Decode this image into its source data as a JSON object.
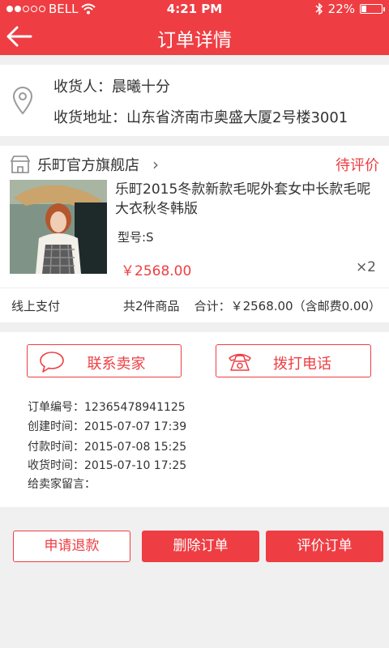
{
  "status_bar": {
    "carrier": "BELL",
    "time": "4:21 PM",
    "battery": "22%",
    "battery_level": 0.22
  },
  "nav": {
    "title": "订单详情"
  },
  "address": {
    "recipient_label": "收货人：",
    "recipient_name": "晨曦十分",
    "address_label": "收货地址：",
    "address_value": "山东省济南市奥盛大厦2号楼3001"
  },
  "order": {
    "shop_name": "乐町官方旗舰店",
    "status": "待评价",
    "product": {
      "name": "乐町2015冬款新款毛呢外套女中长款毛呢大衣秋冬韩版",
      "model": "型号:S",
      "price": "￥2568.00",
      "quantity": "×2"
    },
    "payment_method": "线上支付",
    "item_count": "共2件商品",
    "total": "合计：￥2568.00（含邮费0.00）"
  },
  "contact": {
    "seller_label": "联系卖家",
    "call_label": "拨打电话"
  },
  "info": {
    "order_no": "订单编号：12365478941125",
    "created": "创建时间：2015-07-07 17:39",
    "paid": "付款时间：2015-07-08  15:25",
    "received": "收货时间：2015-07-10  17:25",
    "message": "给卖家留言："
  },
  "actions": {
    "refund": "申请退款",
    "delete": "删除订单",
    "review": "评价订单"
  },
  "colors": {
    "accent": "#ee3e43",
    "background": "#f0f0f0"
  }
}
